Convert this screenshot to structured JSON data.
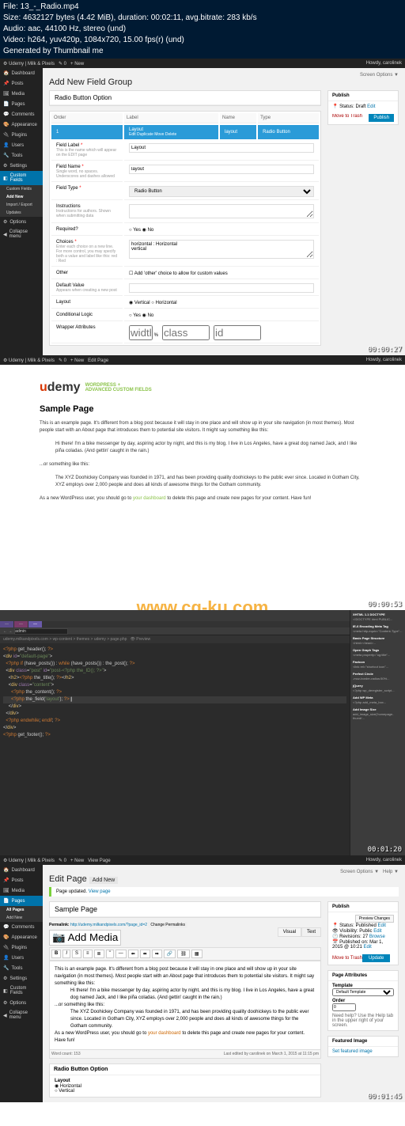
{
  "info": {
    "file": "File: 13_-_Radio.mp4",
    "size": "Size: 4632127 bytes (4.42 MiB), duration: 00:02:11, avg.bitrate: 283 kb/s",
    "audio": "Audio: aac, 44100 Hz, stereo (und)",
    "video": "Video: h264, yuv420p, 1084x720, 15.00 fps(r) (und)",
    "gen": "Generated by Thumbnail me"
  },
  "wp": {
    "site": "Udemy | Milk & Pixels",
    "new": "New",
    "howdy": "Howdy, carolinek",
    "screen_opts": "Screen Options",
    "help": "Help",
    "sidebar": {
      "dashboard": "Dashboard",
      "posts": "Posts",
      "media": "Media",
      "pages": "Pages",
      "comments": "Comments",
      "appearance": "Appearance",
      "plugins": "Plugins",
      "users": "Users",
      "tools": "Tools",
      "settings": "Settings",
      "custom_fields": "Custom Fields",
      "cf_sub1": "Custom Fields",
      "cf_sub2": "Add New",
      "cf_sub3": "Import / Export",
      "cf_sub4": "Updates",
      "options": "Options",
      "collapse": "Collapse menu"
    }
  },
  "acf": {
    "title": "Add New Field Group",
    "group_name": "Radio Button Option",
    "cols": {
      "order": "Order",
      "label": "Label",
      "name": "Name",
      "type": "Type"
    },
    "row": {
      "label": "Layout",
      "sub": "Edit  Duplicate  Move  Delete",
      "name": "layout",
      "type": "Radio Button"
    },
    "fields": {
      "label": "Field Label",
      "label_desc": "This is the name which will appear on the EDIT page",
      "label_val": "Layout",
      "name": "Field Name",
      "name_desc": "Single word, no spaces. Underscores and dashes allowed",
      "name_val": "layout",
      "type": "Field Type",
      "type_val": "Radio Button",
      "instructions": "Instructions",
      "instructions_desc": "Instructions for authors. Shown when submitting data",
      "required": "Required?",
      "choices": "Choices",
      "choices_desc": "Enter each choice on a new line.\nFor more control, you may specify both a value and label like this:\nred : Red",
      "choices_val": "horizontal : Horizontal\nvertical",
      "other": "Other",
      "other_label": "Add 'other' choice to allow for custom values",
      "default": "Default Value",
      "default_desc": "Appears when creating a new post",
      "layout": "Layout",
      "layout_v": "Vertical",
      "layout_h": "Horizontal",
      "cond": "Conditional Logic",
      "wrapper": "Wrapper Attributes",
      "width": "width",
      "class": "class",
      "id": "id",
      "yes": "Yes",
      "no": "No"
    },
    "publish": {
      "title": "Publish",
      "status": "Status: Draft",
      "edit": "Edit",
      "trash": "Move to Trash",
      "btn": "Publish"
    }
  },
  "ts": {
    "f1": "00:00:27",
    "f2": "00:00:53",
    "f3": "00:01:20",
    "f4": "00:01:45"
  },
  "sample": {
    "brand": "udemy",
    "tag1": "WORDPRESS +",
    "tag2": "ADVANCED CUSTOM FIELDS",
    "title": "Sample Page",
    "p1": "This is an example page. It's different from a blog post because it will stay in one place and will show up in your site navigation (in most themes). Most people start with an About page that introduces them to potential site visitors. It might say something like this:",
    "p2": "Hi there! I'm a bike messenger by day, aspiring actor by night, and this is my blog. I live in Los Angeles, have a great dog named Jack, and I like piña coladas. (And gettin' caught in the rain.)",
    "p3": "...or something like this:",
    "p4": "The XYZ Doohickey Company was founded in 1971, and has been providing quality doohickeys to the public ever since. Located in Gotham City, XYZ employs over 2,000 people and does all kinds of awesome things for the Gotham community.",
    "p5a": "As a new WordPress user, you should go to ",
    "p5link": "your dashboard",
    "p5b": " to delete this page and create new pages for your content. Have fun!"
  },
  "watermark": "www.cg-ku.com",
  "ide": {
    "path": "udemy.milkandpixels.com > wp-content > themes > udemy > page.php",
    "preview": "Preview",
    "code_lines": [
      "<?php get_header(); ?>",
      "<div id=\"default-page\">",
      "  <?php if (have_posts()) : while (have_posts()) : the_post(); ?>",
      "  <div class=\"post\" id=\"post-<?php the_ID(); ?>\">",
      "    <h2><?php the_title(); ?></h2>",
      "    <div class=\"content\">",
      "      <?php the_content(); ?>",
      "      <?php the_field('layout'); ?>",
      "    </div>",
      "  </div>",
      "  <?php endwhile; endif; ?>",
      "</div>",
      "<?php get_footer(); ?>"
    ],
    "panels": {
      "p1": "XHTML 1.1 DOCTYPE",
      "p2": "IE-6 Encoding Meta Tag",
      "p3": "Basic Page Structure",
      "p4": "Open Graph Tags",
      "p5": "Favicon",
      "p6": "Perfect Circle",
      "p7": "jQuery",
      "p8": "Add WP Meta",
      "p9": "Add Image Size"
    }
  },
  "edit": {
    "title": "Edit Page",
    "add_new": "Add New",
    "updated": "Page updated.",
    "view": "View page",
    "page_title": "Sample Page",
    "permalink": "Permalink:",
    "permalink_url": "http://udemy.milkandpixels.com/?page_id=2",
    "change_perm": "Change Permalinks",
    "add_media": "Add Media",
    "visual": "Visual",
    "text": "Text",
    "word_count": "Word count: 153",
    "last_edit": "Last edited by carolinek on March 1, 2015 at 11:15 pm",
    "radio_box": "Radio Button Option",
    "layout_label": "Layout",
    "opt_h": "Horizontal",
    "opt_v": "Vertical",
    "publish": {
      "title": "Publish",
      "preview": "Preview Changes",
      "status": "Status: Published",
      "visibility": "Visibility: Public",
      "revisions": "Revisions: 27",
      "published": "Published on: Mar 1, 2015 @ 10:21",
      "edit": "Edit",
      "browse": "Browse",
      "trash": "Move to Trash",
      "update": "Update"
    },
    "attrs": {
      "title": "Page Attributes",
      "template": "Template",
      "template_val": "Default Template",
      "order": "Order",
      "order_val": "0",
      "help": "Need help? Use the Help tab in the upper right of your screen."
    },
    "featured": {
      "title": "Featured Image",
      "set": "Set featured image"
    },
    "sidebar_pages": {
      "all": "All Pages",
      "add": "Add New"
    }
  }
}
